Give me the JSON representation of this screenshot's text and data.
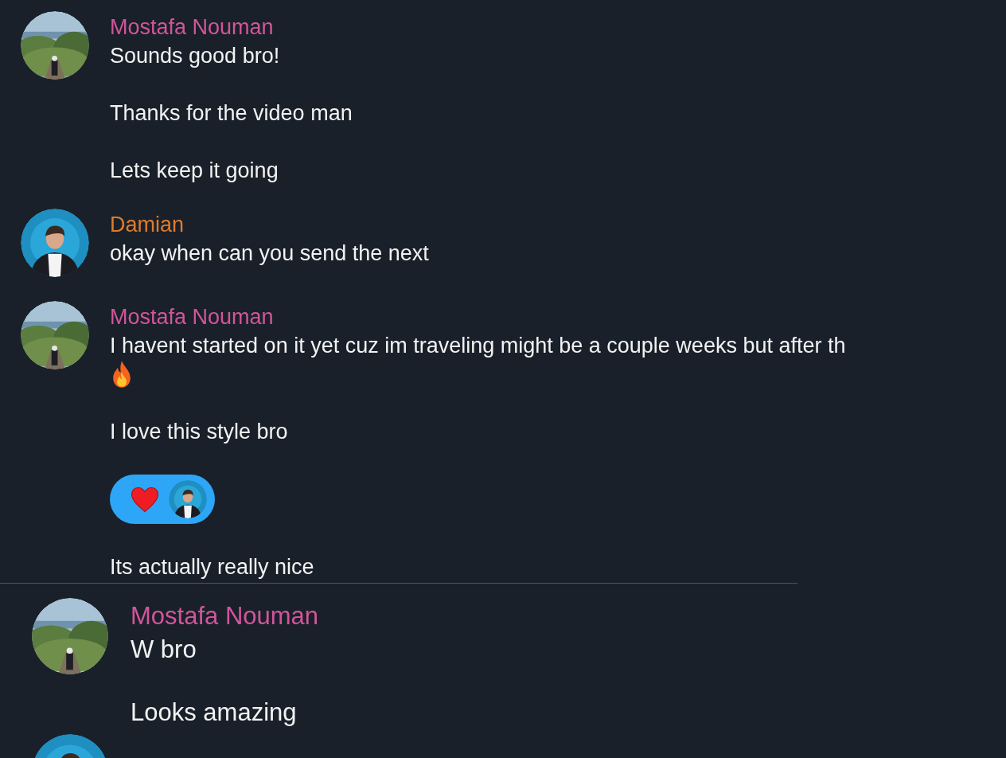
{
  "groups": [
    {
      "author": "Mostafa Nouman",
      "color": "#d2559a",
      "avatar": {
        "kind": "landscape"
      },
      "messages": [
        {
          "kind": "text",
          "text": "Sounds good bro!"
        },
        {
          "kind": "text",
          "text": "Thanks for the video man"
        },
        {
          "kind": "text",
          "text": "Lets keep it going"
        }
      ]
    },
    {
      "author": "Damian",
      "color": "#e07b2a",
      "avatar": {
        "kind": "portrait"
      },
      "messages": [
        {
          "kind": "text",
          "text": "okay when can you send the next"
        }
      ]
    },
    {
      "author": "Mostafa Nouman",
      "color": "#d2559a",
      "avatar": {
        "kind": "landscape"
      },
      "messages": [
        {
          "kind": "text_emoji",
          "text": "I havent started on it yet cuz im traveling might be a couple weeks but after th"
        },
        {
          "kind": "text",
          "text": "I love this style bro"
        },
        {
          "kind": "reaction",
          "avatar": {
            "kind": "portrait"
          }
        },
        {
          "kind": "text",
          "text": "Its actually really nice"
        }
      ]
    }
  ],
  "later_groups": [
    {
      "author": "Mostafa Nouman",
      "color": "#d2559a",
      "avatar": {
        "kind": "landscape"
      },
      "messages": [
        {
          "kind": "text",
          "text": "W bro"
        },
        {
          "kind": "text",
          "text": "Looks amazing"
        }
      ]
    },
    {
      "avatar": {
        "kind": "portrait"
      }
    }
  ]
}
